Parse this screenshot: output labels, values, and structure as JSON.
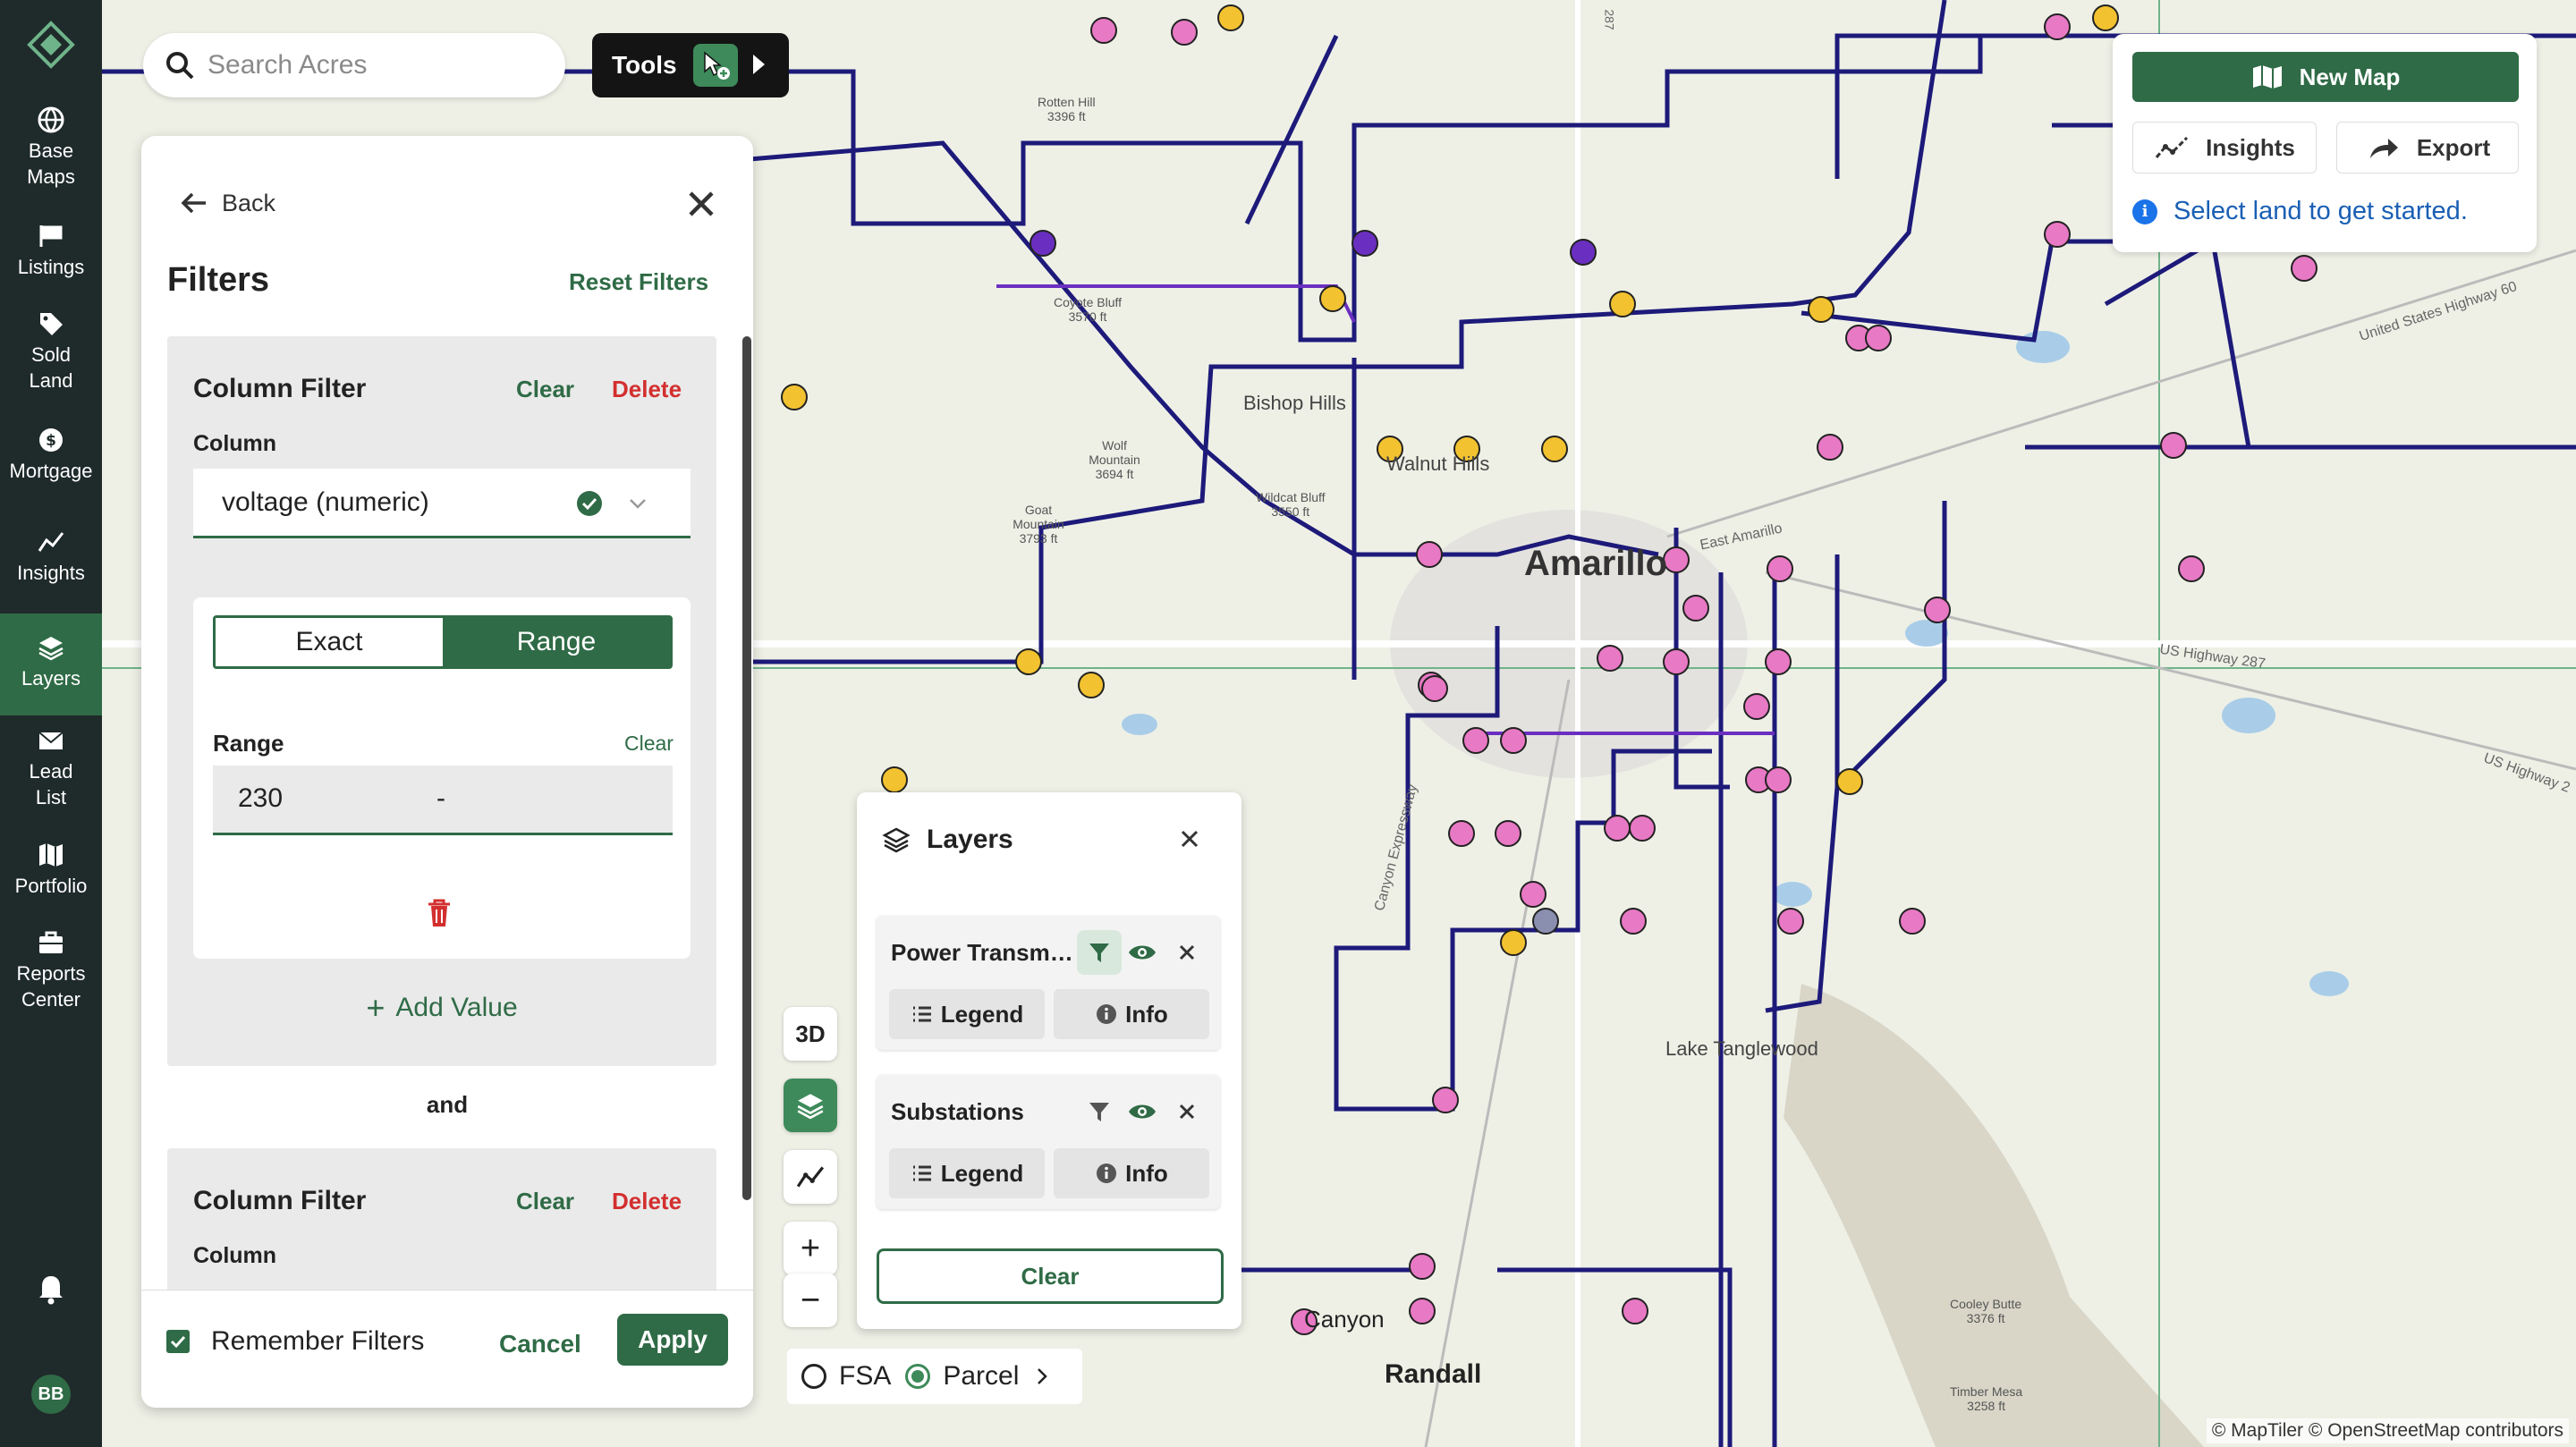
{
  "rail": {
    "items": [
      {
        "label_1": "Base",
        "label_2": "Maps",
        "icon": "globe-icon"
      },
      {
        "label_1": "Listings",
        "label_2": "",
        "icon": "flag-icon"
      },
      {
        "label_1": "Sold",
        "label_2": "Land",
        "icon": "tag-icon"
      },
      {
        "label_1": "Mortgage",
        "label_2": "",
        "icon": "dollar-icon"
      },
      {
        "label_1": "Insights",
        "label_2": "",
        "icon": "trend-icon"
      },
      {
        "label_1": "Layers",
        "label_2": "",
        "icon": "layers-icon"
      },
      {
        "label_1": "Lead",
        "label_2": "List",
        "icon": "mail-icon"
      },
      {
        "label_1": "Portfolio",
        "label_2": "",
        "icon": "map-icon"
      },
      {
        "label_1": "Reports",
        "label_2": "Center",
        "icon": "briefcase-icon"
      }
    ],
    "active": "Layers",
    "avatar": "BB"
  },
  "search": {
    "placeholder": "Search Acres"
  },
  "tools": {
    "label": "Tools"
  },
  "filters": {
    "back": "Back",
    "title": "Filters",
    "reset": "Reset Filters",
    "filter_1": {
      "title": "Column Filter",
      "clear": "Clear",
      "delete": "Delete",
      "column_label": "Column",
      "column_value": "voltage (numeric)",
      "mode_exact": "Exact",
      "mode_range": "Range",
      "mode_selected": "Range",
      "range_label": "Range",
      "range_clear": "Clear",
      "range_min": "230",
      "range_sep": "-",
      "add_value": "Add Value"
    },
    "conjunction": "and",
    "filter_2": {
      "title": "Column Filter",
      "clear": "Clear",
      "delete": "Delete",
      "column_label": "Column"
    },
    "remember": "Remember Filters",
    "cancel": "Cancel",
    "apply": "Apply"
  },
  "map_controls": {
    "three_d": "3D",
    "zoom_in": "+",
    "zoom_out": "−"
  },
  "layers": {
    "title": "Layers",
    "items": [
      {
        "name": "Power Transmission Lines",
        "filter_active": true,
        "legend": "Legend",
        "info": "Info"
      },
      {
        "name": "Substations",
        "filter_active": false,
        "legend": "Legend",
        "info": "Info"
      }
    ],
    "clear": "Clear"
  },
  "basebar": {
    "fsa": "FSA",
    "parcel": "Parcel",
    "selected": "Parcel"
  },
  "right_panel": {
    "new_map": "New Map",
    "insights": "Insights",
    "export": "Export",
    "hint": "Select land to get started."
  },
  "map_labels": {
    "city": "Amarillo",
    "county": "Randall",
    "places": [
      "Bishop Hills",
      "Walnut Hills",
      "Canyon",
      "Lake Tanglewood",
      "East Amarillo",
      "Canyon Expressway"
    ],
    "peaks": [
      {
        "name": "Rotten Hill",
        "elev": "3396 ft"
      },
      {
        "name": "Coyote Bluff",
        "elev": "3570 ft"
      },
      {
        "name": "Wolf Mountain",
        "elev": "3694 ft"
      },
      {
        "name": "Goat Mountain",
        "elev": "3793 ft"
      },
      {
        "name": "Wildcat Bluff",
        "elev": "3550 ft"
      },
      {
        "name": "Cooley Butte",
        "elev": "3376 ft"
      },
      {
        "name": "Timber Mesa",
        "elev": "3258 ft"
      }
    ],
    "roads": [
      "United States Highway 60",
      "US Highway 287",
      "US Highway 2",
      "287"
    ],
    "attribution": "© MapTiler © OpenStreetMap contributors"
  },
  "colors": {
    "brand": "#2f6b46",
    "rail": "#1f2a2a",
    "line": "#1d1a7a",
    "substation_pink": "#e879c4",
    "substation_yellow": "#f2c230",
    "delete": "#d32f2f"
  }
}
